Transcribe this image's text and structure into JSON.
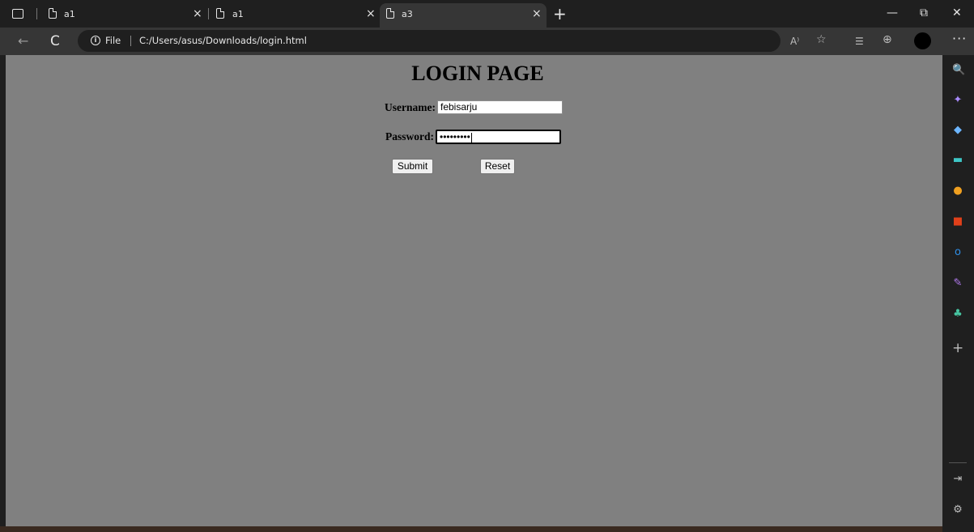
{
  "tabs": [
    {
      "title": "a1",
      "active": false
    },
    {
      "title": "a1",
      "active": false
    },
    {
      "title": "a3",
      "active": true
    }
  ],
  "tab_close_glyph": "×",
  "newtab_glyph": "+",
  "window_controls": {
    "minimize": "—",
    "restore": "⧉",
    "close": "✕"
  },
  "toolbar": {
    "back_glyph": "←",
    "reload_glyph": "C",
    "info_glyph": "i",
    "scheme": "File",
    "url": "C:/Users/asus/Downloads/login.html",
    "read_aloud": "A⁾",
    "favorite": "☆",
    "favorites": "☰",
    "collections": "⊕",
    "more": "···"
  },
  "page": {
    "title": "LOGIN PAGE",
    "username_label": "Username:",
    "username_value": "febisarju",
    "password_label": "Password:",
    "password_value": "•••••••••",
    "submit_label": "Submit",
    "reset_label": "Reset"
  },
  "sidebar": {
    "icons": [
      {
        "name": "search-icon",
        "glyph": "🔍",
        "color": "#4aa3ff"
      },
      {
        "name": "copilot-sparkle-icon",
        "glyph": "✦",
        "color": "#a98bff"
      },
      {
        "name": "shopping-tag-icon",
        "glyph": "◆",
        "color": "#6cb6ff"
      },
      {
        "name": "tools-briefcase-icon",
        "glyph": "▬",
        "color": "#3ec6c6"
      },
      {
        "name": "games-icon",
        "glyph": "●",
        "color": "#f0a020"
      },
      {
        "name": "office-icon",
        "glyph": "■",
        "color": "#e0401a"
      },
      {
        "name": "outlook-icon",
        "glyph": "o",
        "color": "#2f8fe8"
      },
      {
        "name": "designer-icon",
        "glyph": "✎",
        "color": "#b37bf0"
      },
      {
        "name": "tree-icon",
        "glyph": "♣",
        "color": "#46c4a0"
      },
      {
        "name": "add-icon",
        "glyph": "+",
        "color": "#bdbdbd"
      }
    ],
    "bottom_icons": [
      {
        "name": "sidebar-toggle-icon",
        "glyph": "⇥",
        "color": "#bdbdbd"
      },
      {
        "name": "settings-gear-icon",
        "glyph": "⚙",
        "color": "#bdbdbd"
      }
    ]
  },
  "colors": {
    "page_background": "#808080",
    "chrome_dark": "#1f1f1f",
    "chrome_toolbar": "#363636"
  }
}
